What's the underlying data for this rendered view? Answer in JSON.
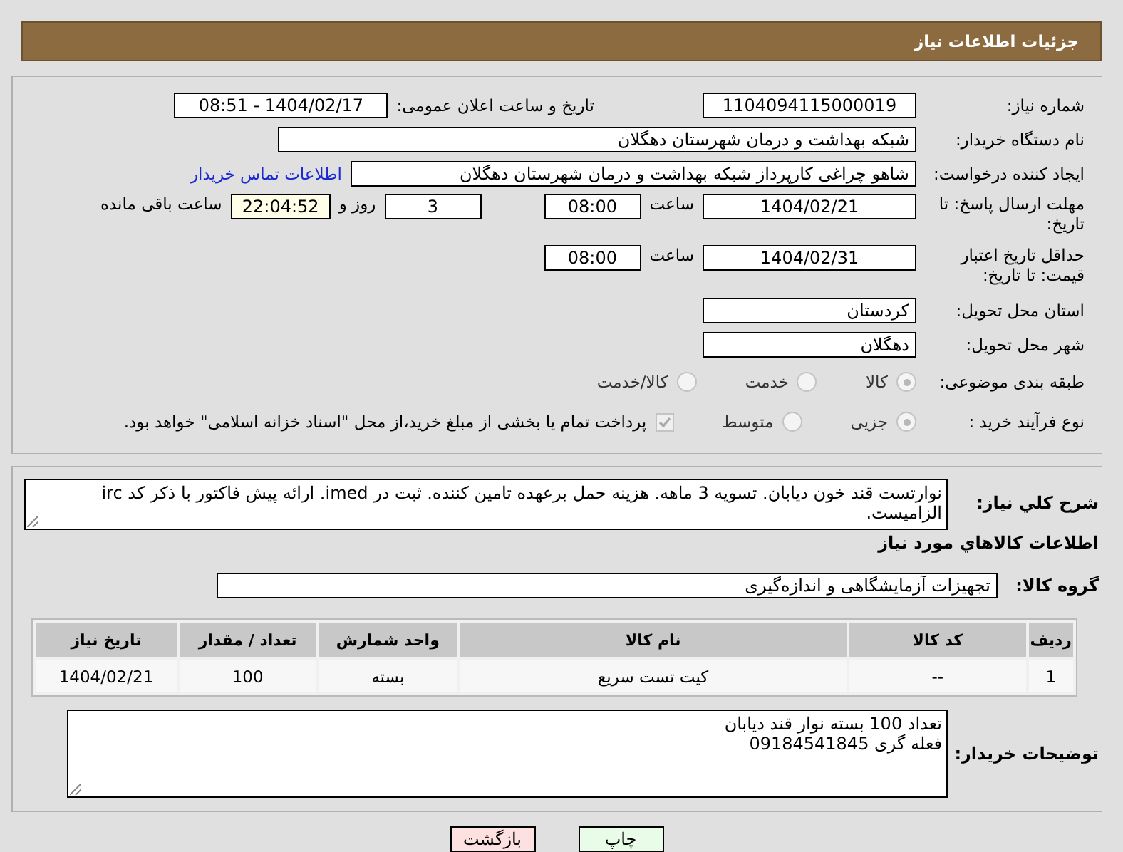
{
  "header": {
    "title": "جزئیات اطلاعات نیاز"
  },
  "need_number": {
    "label": "شماره نیاز:",
    "value": "1104094115000019"
  },
  "announce": {
    "label": "تاریخ و ساعت اعلان عمومی:",
    "value": "1404/02/17 - 08:51"
  },
  "buyer_org": {
    "label": "نام دستگاه خریدار:",
    "value": "شبکه بهداشت و درمان شهرستان دهگلان"
  },
  "requester": {
    "label": "ایجاد کننده درخواست:",
    "value": "شاهو چراغی کارپرداز شبکه بهداشت و درمان شهرستان دهگلان",
    "link": "اطلاعات تماس خریدار"
  },
  "deadline": {
    "label": "مهلت ارسال پاسخ: تا تاریخ:",
    "date": "1404/02/21",
    "time_label": "ساعت",
    "time": "08:00",
    "days": "3",
    "days_label": "روز و",
    "remaining": "22:04:52",
    "remaining_label": "ساعت باقی مانده"
  },
  "price_validity": {
    "label": "حداقل تاریخ اعتبار قیمت: تا تاریخ:",
    "date": "1404/02/31",
    "time_label": "ساعت",
    "time": "08:00"
  },
  "province": {
    "label": "استان محل تحویل:",
    "value": "کردستان"
  },
  "city": {
    "label": "شهر محل تحویل:",
    "value": "دهگلان"
  },
  "category": {
    "label": "طبقه بندی موضوعی:",
    "options": [
      {
        "label": "کالا",
        "selected": true
      },
      {
        "label": "خدمت",
        "selected": false
      },
      {
        "label": "کالا/خدمت",
        "selected": false
      }
    ]
  },
  "process": {
    "label": "نوع فرآیند خرید :",
    "options": [
      {
        "label": "جزیی",
        "selected": true
      },
      {
        "label": "متوسط",
        "selected": false
      }
    ],
    "treasury": {
      "checked": true,
      "label": "پرداخت تمام یا بخشی از مبلغ خرید،از محل \"اسناد خزانه اسلامی\" خواهد بود."
    }
  },
  "summary": {
    "label": "شرح کلي نياز:",
    "value": "نوارتست قند خون دیابان. تسویه 3 ماهه. هزینه حمل برعهده تامین کننده. ثبت در imed. ارائه پیش فاکتور با ذکر کد irc الزامیست."
  },
  "goods_heading": "اطلاعات کالاهاي مورد نياز",
  "goods_group": {
    "label": "گروه کالا:",
    "value": "تجهیزات آزمایشگاهی و اندازه‌گیری"
  },
  "table": {
    "columns": [
      "ردیف",
      "کد کالا",
      "نام کالا",
      "واحد شمارش",
      "تعداد / مقدار",
      "تاریخ نیاز"
    ],
    "rows": [
      [
        "1",
        "--",
        "کیت تست سریع",
        "بسته",
        "100",
        "1404/02/21"
      ]
    ]
  },
  "buyer_notes": {
    "label": "توضیحات خریدار:",
    "lines": [
      "تعداد 100 بسته نوار قند دیابان",
      "فعله گری 09184541845"
    ]
  },
  "buttons": [
    {
      "label": "چاپ",
      "kind": "print"
    },
    {
      "label": "بازگشت",
      "kind": "back"
    }
  ]
}
